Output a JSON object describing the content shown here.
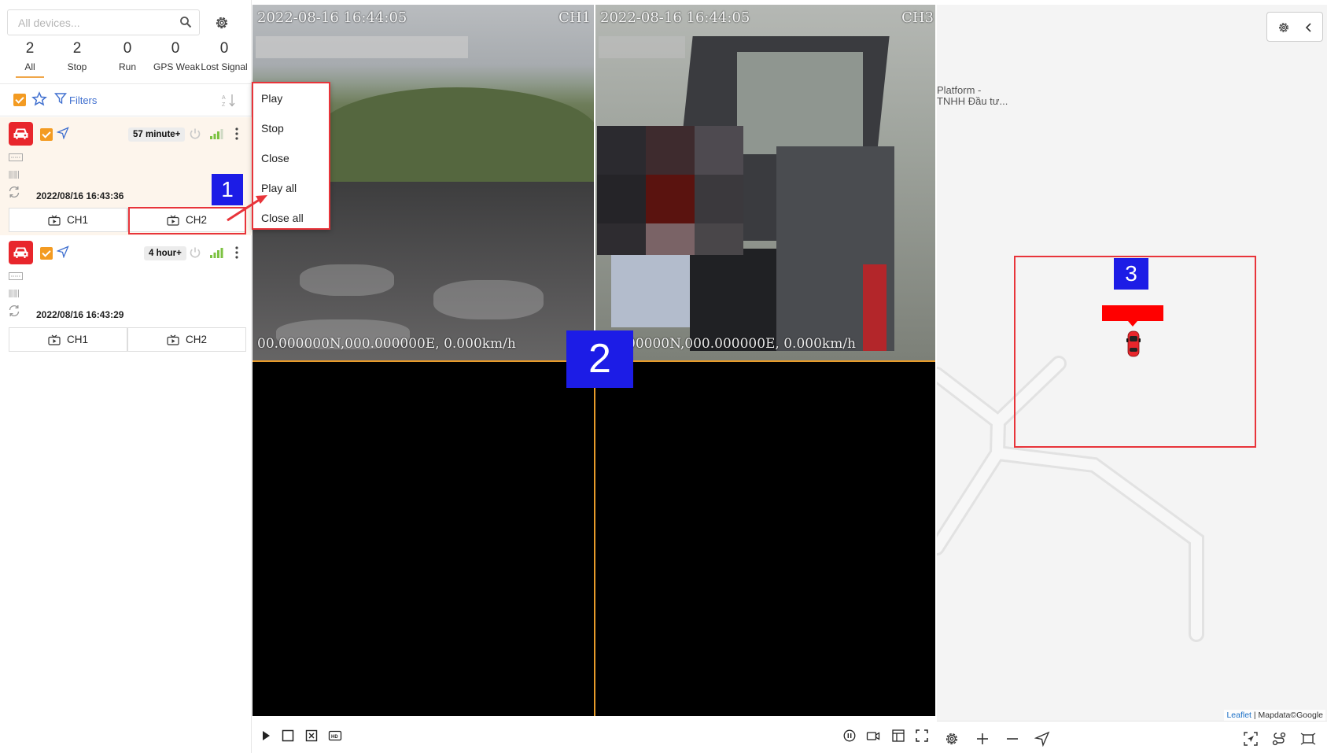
{
  "search": {
    "placeholder": "All devices..."
  },
  "stats": [
    {
      "count": "2",
      "label": "All"
    },
    {
      "count": "2",
      "label": "Stop"
    },
    {
      "count": "0",
      "label": "Run"
    },
    {
      "count": "0",
      "label": "GPS Weak"
    },
    {
      "count": "0",
      "label": "Lost Signal"
    }
  ],
  "toolbar": {
    "filters_label": "Filters"
  },
  "devices": [
    {
      "status_badge": "57 minute+",
      "datetime": "2022/08/16 16:43:36",
      "ch1": "CH1",
      "ch2": "CH2"
    },
    {
      "status_badge": "4 hour+",
      "datetime": "2022/08/16 16:43:29",
      "ch1": "CH1",
      "ch2": "CH2"
    }
  ],
  "context_menu": {
    "items": [
      "Play",
      "Stop",
      "Close",
      "Play all",
      "Close all"
    ]
  },
  "video": {
    "cam1": {
      "timestamp": "2022-08-16 16:44:05",
      "channel": "CH1",
      "coords": "00.000000N,000.000000E, 0.000km/h"
    },
    "cam3": {
      "timestamp": "2022-08-16 16:44:05",
      "channel": "CH3",
      "coords": "00000N,000.000000E, 0.000km/h"
    }
  },
  "map": {
    "label_line1": "Platform -",
    "label_line2": "TNHH Đầu tư...",
    "attribution_leaflet": "Leaflet",
    "attribution_rest": " | Mapdata©Google"
  },
  "annotations": {
    "badge1": "1",
    "badge2": "2",
    "badge3": "3"
  },
  "colors": {
    "accent": "#f39b22",
    "alert_red": "#e8262c",
    "annotation_blue": "#1c1ce6",
    "link_blue": "#3f6fcf"
  },
  "icons": {
    "search": "search-icon",
    "settings": "gear-icon",
    "favorite": "star-icon",
    "filter": "filter-icon",
    "sort": "sort-icon",
    "vehicle": "car-icon",
    "locate": "navigation-icon",
    "power": "power-icon",
    "signal": "signal-icon",
    "more": "more-vertical-icon",
    "sync": "sync-icon",
    "camera": "camera-icon",
    "collapse": "chevron-left-icon",
    "zoom_in": "plus-icon",
    "zoom_out": "minus-icon"
  }
}
